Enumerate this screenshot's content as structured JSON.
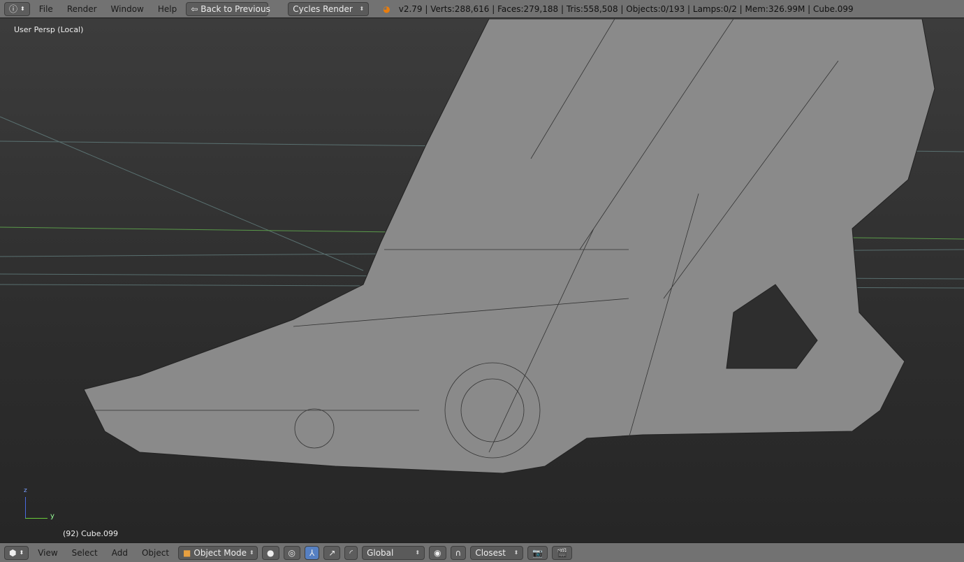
{
  "top_bar": {
    "info_icon": "info-icon",
    "menus": [
      "File",
      "Render",
      "Window",
      "Help"
    ],
    "back_button": "Back to Previous",
    "render_engine": "Cycles Render",
    "stats": "v2.79 | Verts:288,616 | Faces:279,188 | Tris:558,508 | Objects:0/193 | Lamps:0/2 | Mem:326.99M | Cube.099"
  },
  "viewport": {
    "view_label": "User Persp (Local)",
    "object_label": "(92) Cube.099",
    "axis_z": "z",
    "axis_y": "y"
  },
  "bottom_bar": {
    "menus": [
      "View",
      "Select",
      "Add",
      "Object"
    ],
    "mode": "Object Mode",
    "orientation": "Global",
    "snap_target": "Closest"
  },
  "colors": {
    "header": "#727272",
    "viewport": "#393939",
    "mesh": "#8a8a8a",
    "accent": "#5680c2"
  }
}
